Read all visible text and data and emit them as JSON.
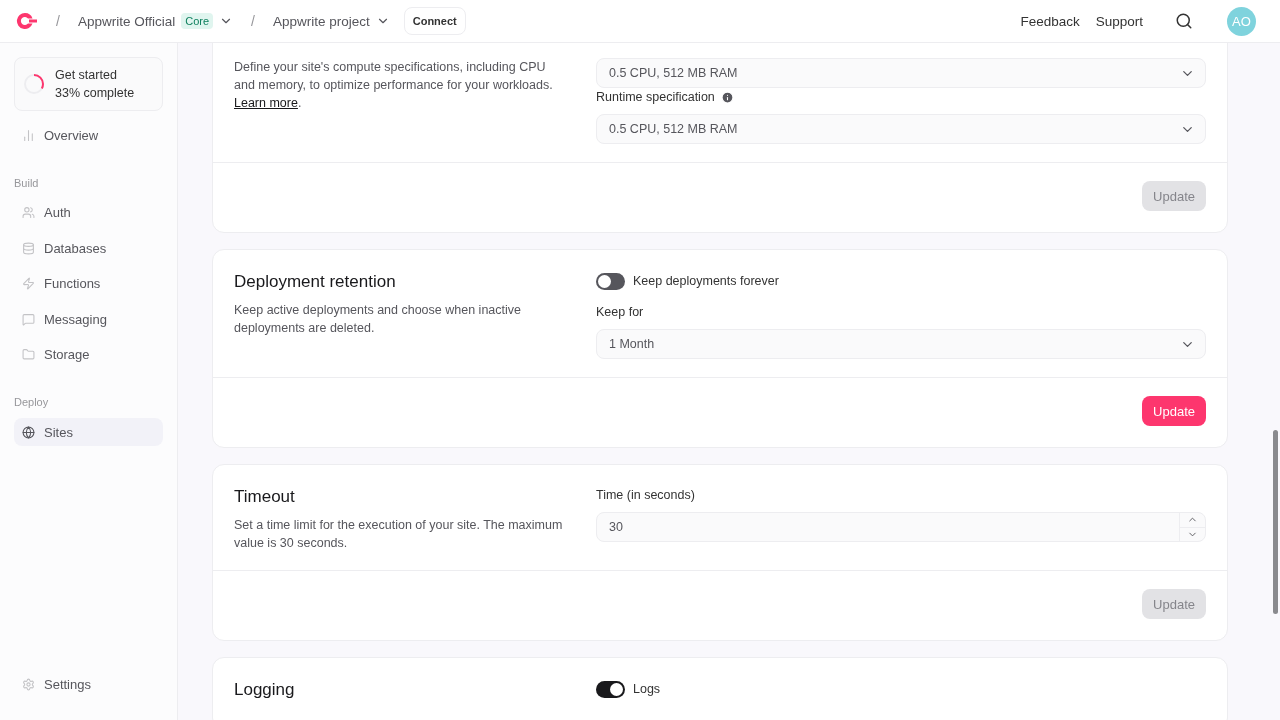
{
  "header": {
    "org": {
      "name": "Appwrite Official",
      "badge": "Core"
    },
    "separator": "/",
    "project": "Appwrite project",
    "connect": "Connect",
    "links": [
      "Feedback",
      "Support"
    ],
    "avatar": "AO"
  },
  "sidebar": {
    "progress": {
      "title": "Get started",
      "subtitle": "33% complete",
      "level": 0.33
    },
    "groups": [
      {
        "items": [
          {
            "label": "Overview",
            "selected": false
          }
        ]
      },
      {
        "heading": "Build",
        "items": [
          {
            "label": "Auth",
            "selected": false
          },
          {
            "label": "Databases",
            "selected": false
          },
          {
            "label": "Functions",
            "selected": false
          },
          {
            "label": "Messaging",
            "selected": false
          },
          {
            "label": "Storage",
            "selected": false
          }
        ]
      },
      {
        "heading": "Deploy",
        "items": [
          {
            "label": "Sites",
            "selected": true
          }
        ]
      }
    ],
    "settings": {
      "label": "Settings",
      "selected": false
    }
  },
  "sections": [
    {
      "description": "Define your site's compute specifications, including CPU and memory, to optimize performance for your workloads.",
      "link": "Learn more",
      "link_suffix": ".",
      "fields": [
        {
          "kind": "select",
          "value": "0.5 CPU, 512 MB RAM"
        },
        {
          "kind": "select",
          "label": "Runtime specification",
          "info": true,
          "value": "0.5 CPU, 512 MB RAM"
        }
      ],
      "button": {
        "label": "Update",
        "disabled": true
      }
    },
    {
      "title": "Deployment retention",
      "description": "Keep active deployments and choose when inactive deployments are deleted.",
      "fields": [
        {
          "kind": "toggle",
          "label": "Keep deployments forever",
          "on": false
        },
        {
          "kind": "select",
          "label": "Keep for",
          "info": false,
          "value": "1 Month"
        }
      ],
      "button": {
        "label": "Update",
        "disabled": false
      }
    },
    {
      "title": "Timeout",
      "description": "Set a time limit for the execution of your site. The maximum value is 30 seconds.",
      "fields": [
        {
          "kind": "number",
          "label": "Time (in seconds)",
          "value": "30"
        }
      ],
      "button": {
        "label": "Update",
        "disabled": true
      }
    },
    {
      "title": "Logging",
      "fields": [
        {
          "kind": "toggle",
          "label": "Logs",
          "on": true
        }
      ]
    }
  ]
}
